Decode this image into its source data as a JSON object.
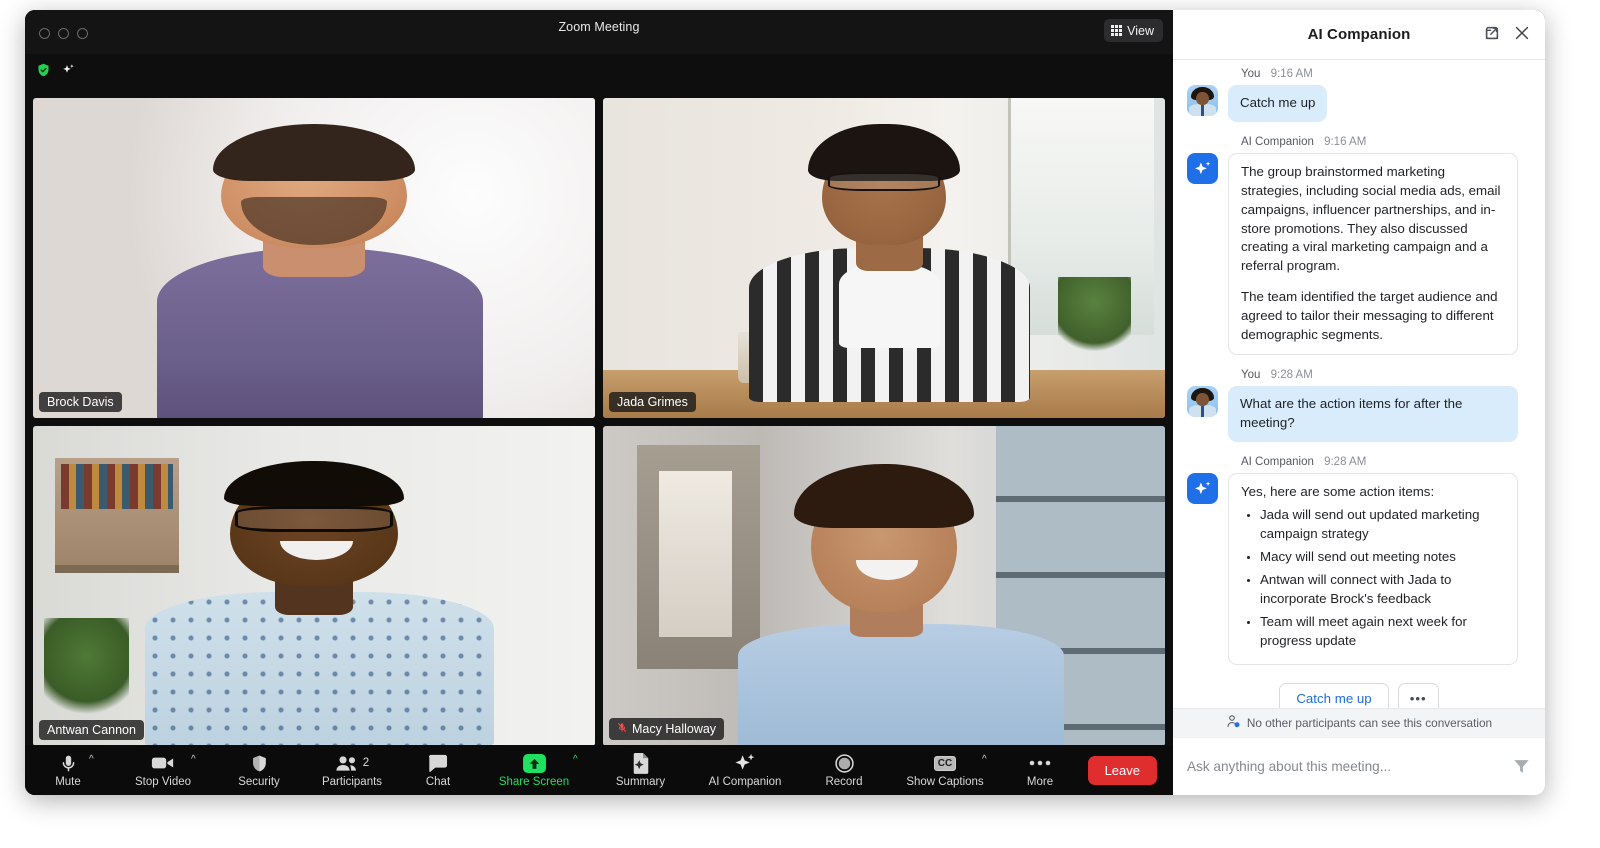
{
  "window": {
    "title": "Zoom Meeting",
    "view_button": "View",
    "traffic_lights": [
      "close",
      "minimize",
      "maximize"
    ],
    "status_icons": [
      "shield-check-icon",
      "sparkle-icon"
    ]
  },
  "participants": [
    {
      "name": "Brock Davis",
      "muted": false,
      "active_speaker": false
    },
    {
      "name": "Jada Grimes",
      "muted": false,
      "active_speaker": false
    },
    {
      "name": "Antwan Cannon",
      "muted": false,
      "active_speaker": true
    },
    {
      "name": "Macy Halloway",
      "muted": true,
      "active_speaker": false
    }
  ],
  "toolbar": {
    "items": [
      {
        "label": "Mute",
        "icon": "microphone-icon",
        "caret": true,
        "badge": null,
        "accent": false
      },
      {
        "label": "Stop Video",
        "icon": "video-camera-icon",
        "caret": true,
        "badge": null,
        "accent": false
      },
      {
        "label": "Security",
        "icon": "shield-icon",
        "caret": false,
        "badge": null,
        "accent": false
      },
      {
        "label": "Participants",
        "icon": "people-icon",
        "caret": false,
        "badge": "2",
        "accent": false
      },
      {
        "label": "Chat",
        "icon": "chat-bubble-icon",
        "caret": false,
        "badge": null,
        "accent": false
      },
      {
        "label": "Share Screen",
        "icon": "share-arrow-up-icon",
        "caret": true,
        "badge": null,
        "accent": true
      },
      {
        "label": "Summary",
        "icon": "document-sparkle-icon",
        "caret": false,
        "badge": null,
        "accent": false
      },
      {
        "label": "AI Companion",
        "icon": "sparkle-icon",
        "caret": false,
        "badge": null,
        "accent": false
      },
      {
        "label": "Record",
        "icon": "record-circle-icon",
        "caret": false,
        "badge": null,
        "accent": false
      },
      {
        "label": "Show Captions",
        "icon": "cc-icon",
        "caret": true,
        "badge": null,
        "accent": false
      },
      {
        "label": "More",
        "icon": "ellipsis-icon",
        "caret": false,
        "badge": null,
        "accent": false
      }
    ],
    "leave_label": "Leave",
    "accent_color": "#20e05f",
    "leave_color": "#e02d2d"
  },
  "ai_panel": {
    "title": "AI Companion",
    "header_buttons": [
      "popout-icon",
      "close-icon"
    ],
    "messages": [
      {
        "sender": "You",
        "time": "9:16 AM",
        "type": "user",
        "text": "Catch me up"
      },
      {
        "sender": "AI Companion",
        "time": "9:16 AM",
        "type": "ai",
        "paragraphs": [
          "The group brainstormed marketing strategies, including social media ads, email campaigns, influencer partnerships, and in-store promotions. They also discussed creating a viral marketing campaign and a referral program.",
          "The team identified the target audience and agreed to tailor their messaging to different demographic segments."
        ]
      },
      {
        "sender": "You",
        "time": "9:28 AM",
        "type": "user",
        "text": "What are the action items for after the meeting?"
      },
      {
        "sender": "AI Companion",
        "time": "9:28 AM",
        "type": "ai",
        "intro": "Yes, here are some action items:",
        "bullets": [
          "Jada will send out updated marketing campaign strategy",
          "Macy will send out meeting notes",
          "Antwan will connect with Jada to incorporate Brock's feedback",
          "Team will meet again next week for progress update"
        ]
      }
    ],
    "quick_actions": {
      "primary": "Catch me up",
      "more": "•••"
    },
    "privacy_note": "No other participants can see this conversation",
    "composer": {
      "placeholder": "Ask anything about this meeting...",
      "value": ""
    }
  }
}
